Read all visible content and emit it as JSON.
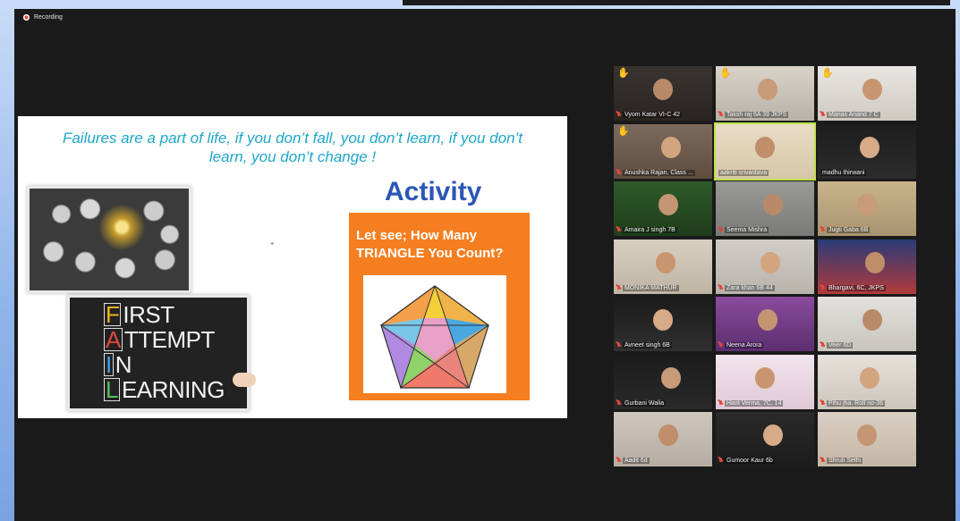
{
  "recording": {
    "label": "Recording"
  },
  "slide": {
    "quote": "Failures are a part of life, if you don’t fall, you don’t learn, if you don’t\nlearn, you don’t change !",
    "activity_title": "Activity",
    "question_line1": "Let see; How Many",
    "question_line2": "TRIANGLE You Count?",
    "fail_acronym": [
      {
        "letter": "F",
        "rest": "IRST",
        "color": "#f2b01e"
      },
      {
        "letter": "A",
        "rest": "TTEMPT",
        "color": "#e0463c"
      },
      {
        "letter": "I",
        "rest": "N",
        "color": "#3aa0e8"
      },
      {
        "letter": "L",
        "rest": "EARNING",
        "color": "#55c25a"
      }
    ]
  },
  "participants": [
    {
      "name": "Vyom Katar VI-C 42",
      "hand_raised": true,
      "muted": true
    },
    {
      "name": "Taksh raj 6A 39 JKPS",
      "hand_raised": true,
      "muted": true
    },
    {
      "name": "Manas Anand 7 C",
      "hand_raised": true,
      "muted": true
    },
    {
      "name": "Anushka Rajan, Class ...",
      "hand_raised": true,
      "muted": true
    },
    {
      "name": "aakriti srivastava",
      "hand_raised": false,
      "muted": false,
      "active_speaker": true
    },
    {
      "name": "madhu thirwani",
      "hand_raised": false,
      "muted": false
    },
    {
      "name": "Amaira J singh 7B",
      "hand_raised": false,
      "muted": true
    },
    {
      "name": "Seema Mishra",
      "hand_raised": false,
      "muted": true
    },
    {
      "name": "Jugti Gaba 6B",
      "hand_raised": false,
      "muted": true
    },
    {
      "name": "MONIKA MATHUR",
      "hand_raised": false,
      "muted": true
    },
    {
      "name": "Zara khan 6B 44",
      "hand_raised": false,
      "muted": true
    },
    {
      "name": "Bhargavi, 6C, JKPS",
      "hand_raised": false,
      "muted": true
    },
    {
      "name": "Avneet singh 6B",
      "hand_raised": false,
      "muted": true
    },
    {
      "name": "Neena Arora",
      "hand_raised": false,
      "muted": true
    },
    {
      "name": "Veer 6D",
      "hand_raised": false,
      "muted": true
    },
    {
      "name": "Gurbani Walia",
      "hand_raised": false,
      "muted": true
    },
    {
      "name": "Harit Verma, 7C, 14",
      "hand_raised": false,
      "muted": true
    },
    {
      "name": "Pihu jha. Roll no-36",
      "hand_raised": false,
      "muted": true
    },
    {
      "name": "Aadit 6d",
      "hand_raised": false,
      "muted": true
    },
    {
      "name": "Gumoor Kaur 6b",
      "hand_raised": false,
      "muted": true
    },
    {
      "name": "Shruti Sethi",
      "hand_raised": false,
      "muted": true
    }
  ]
}
